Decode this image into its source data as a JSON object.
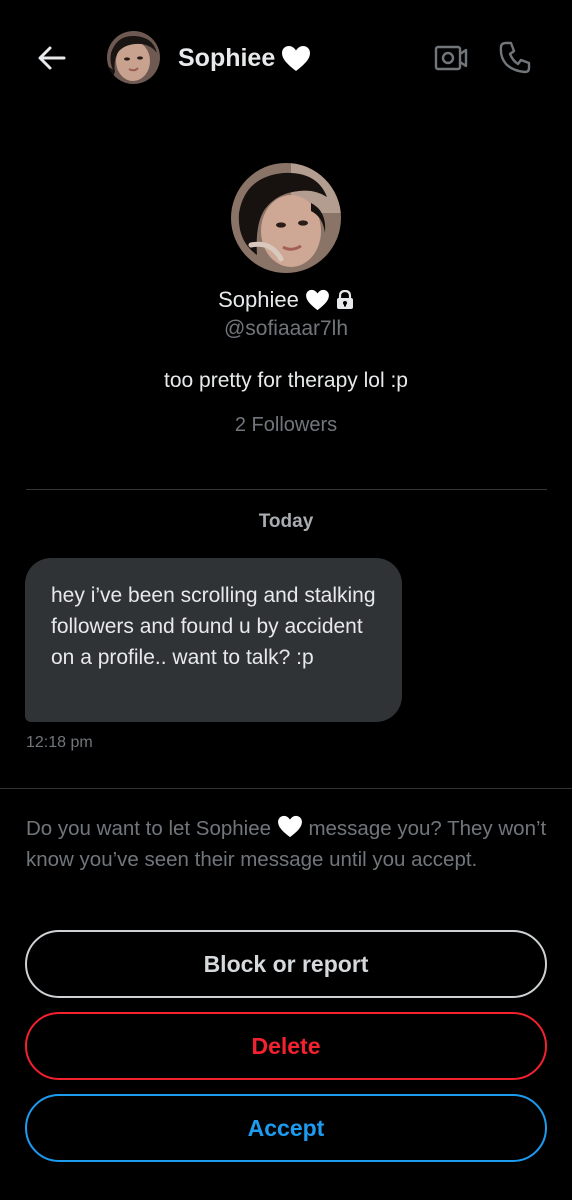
{
  "header": {
    "name": "Sophiee",
    "back_icon": "arrow-left-icon",
    "video_icon": "video-camera-icon",
    "call_icon": "phone-icon"
  },
  "profile": {
    "name": "Sophiee",
    "handle": "@sofiaaar7lh",
    "bio": "too pretty for therapy lol :p",
    "followers": "2 Followers",
    "locked": true,
    "name_emoji": "white-heart-icon"
  },
  "conversation": {
    "date_label": "Today",
    "messages": [
      {
        "text": "hey i’ve been scrolling and stalking followers and found u by accident on a profile.. want to talk? :p",
        "time": "12:18 pm"
      }
    ]
  },
  "request": {
    "prompt_before": "Do you want to let Sophiee",
    "prompt_after": "message you? They won’t know you’ve seen their message until you accept."
  },
  "actions": {
    "block_label": "Block or report",
    "delete_label": "Delete",
    "accept_label": "Accept"
  },
  "colors": {
    "background": "#000000",
    "bubble": "#2f3336",
    "muted_text": "#71767b",
    "delete": "#f4212e",
    "accept": "#1d9bf0"
  }
}
